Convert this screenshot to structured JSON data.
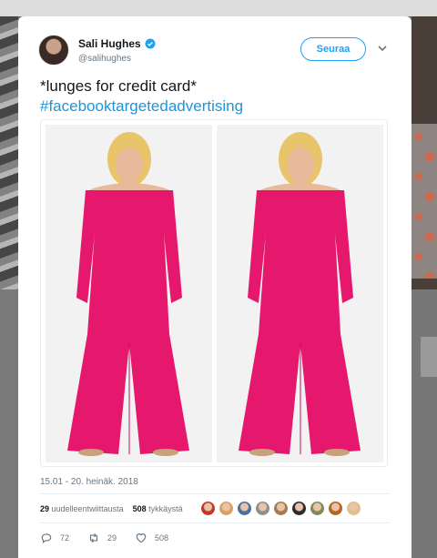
{
  "tweet": {
    "author_name": "Sali Hughes",
    "author_handle": "@salihughes",
    "follow_label": "Seuraa",
    "text": "*lunges for credit card*",
    "hashtag": "#facebooktargetedadvertising",
    "timestamp": "15.01 - 20. heinäk. 2018"
  },
  "stats": {
    "retweets_count": "29",
    "retweets_label": "uudelleentwiittausta",
    "likes_count": "508",
    "likes_label": "tykkäystä"
  },
  "actions": {
    "replies": "72",
    "retweets": "29",
    "likes": "508"
  },
  "icons": {
    "verified": "verified-badge-icon",
    "caret": "chevron-down-icon",
    "reply": "reply-icon",
    "retweet": "retweet-icon",
    "like": "heart-icon"
  },
  "colors": {
    "accent": "#1da1f2",
    "hashtag": "#1b95e0",
    "jumpsuit": "#e6186e",
    "liker_avatars": [
      "#c0392b",
      "#d9a066",
      "#4a6fa5",
      "#8e8e8e",
      "#a57c52",
      "#2c2c2c",
      "#7d8c5a",
      "#b5651d",
      "#e0c08a"
    ]
  }
}
